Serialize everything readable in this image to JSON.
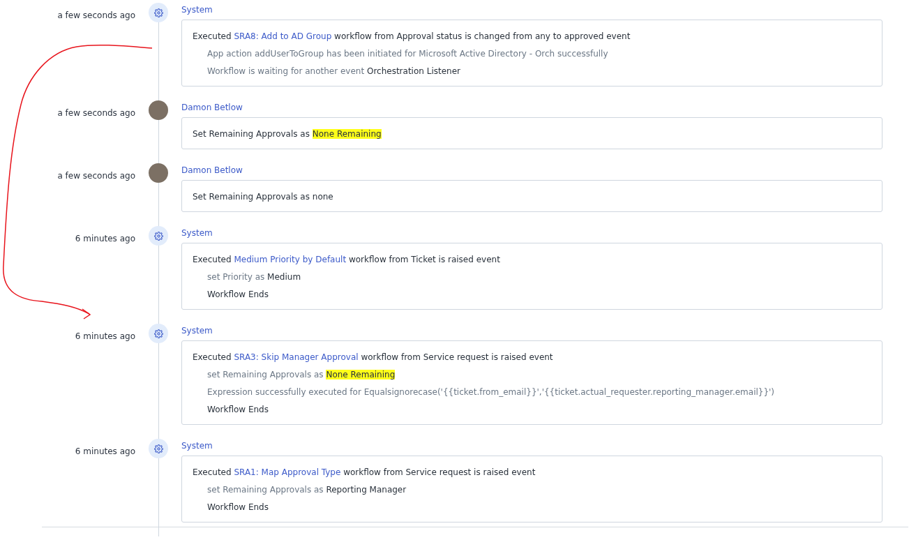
{
  "events": [
    {
      "time": "a few seconds ago",
      "actor": {
        "kind": "system",
        "name": "System"
      },
      "lines": [
        {
          "kind": "head",
          "segments": [
            {
              "kind": "text",
              "text": "Executed ",
              "highlighted": false
            },
            {
              "kind": "link",
              "text": "SRA8: Add to AD Group",
              "highlighted": false
            },
            {
              "kind": "text",
              "text": " workflow from Approval status is changed from any to approved event",
              "highlighted": false
            }
          ]
        },
        {
          "kind": "step",
          "segments": [
            {
              "kind": "muted",
              "text": "App action addUserToGroup has been initiated for Microsoft Active Directory - Orch successfully",
              "highlighted": false
            }
          ]
        },
        {
          "kind": "step",
          "segments": [
            {
              "kind": "muted",
              "text": "Workflow is waiting for another event ",
              "highlighted": false
            },
            {
              "kind": "text",
              "text": "Orchestration Listener",
              "highlighted": false
            }
          ]
        }
      ]
    },
    {
      "time": "a few seconds ago",
      "actor": {
        "kind": "user",
        "name": "Damon Betlow"
      },
      "lines": [
        {
          "kind": "head",
          "segments": [
            {
              "kind": "text",
              "text": "Set Remaining Approvals as ",
              "highlighted": false
            },
            {
              "kind": "text",
              "text": "None Remaining",
              "highlighted": true
            }
          ]
        }
      ]
    },
    {
      "time": "a few seconds ago",
      "actor": {
        "kind": "user",
        "name": "Damon Betlow"
      },
      "lines": [
        {
          "kind": "head",
          "segments": [
            {
              "kind": "text",
              "text": "Set Remaining Approvals as none",
              "highlighted": false
            }
          ]
        }
      ]
    },
    {
      "time": "6 minutes ago",
      "actor": {
        "kind": "system",
        "name": "System"
      },
      "lines": [
        {
          "kind": "head",
          "segments": [
            {
              "kind": "text",
              "text": "Executed ",
              "highlighted": false
            },
            {
              "kind": "link",
              "text": "Medium Priority by Default",
              "highlighted": false
            },
            {
              "kind": "text",
              "text": " workflow from Ticket is raised event",
              "highlighted": false
            }
          ]
        },
        {
          "kind": "step",
          "segments": [
            {
              "kind": "muted",
              "text": "set Priority as ",
              "highlighted": false
            },
            {
              "kind": "text",
              "text": "Medium",
              "highlighted": false
            }
          ]
        },
        {
          "kind": "step",
          "segments": [
            {
              "kind": "text",
              "text": "Workflow Ends",
              "highlighted": false
            }
          ]
        }
      ]
    },
    {
      "time": "6 minutes ago",
      "actor": {
        "kind": "system",
        "name": "System"
      },
      "lines": [
        {
          "kind": "head",
          "segments": [
            {
              "kind": "text",
              "text": "Executed ",
              "highlighted": false
            },
            {
              "kind": "link",
              "text": "SRA3: Skip Manager Approval",
              "highlighted": false
            },
            {
              "kind": "text",
              "text": " workflow from Service request is raised event",
              "highlighted": false
            }
          ]
        },
        {
          "kind": "step",
          "segments": [
            {
              "kind": "muted",
              "text": "set Remaining Approvals as ",
              "highlighted": false
            },
            {
              "kind": "text",
              "text": "None Remaining",
              "highlighted": true
            }
          ]
        },
        {
          "kind": "step",
          "segments": [
            {
              "kind": "muted",
              "text": "Expression successfully executed for Equalsignorecase('{{ticket.from_email}}','{{ticket.actual_requester.reporting_manager.email}}')",
              "highlighted": false
            }
          ]
        },
        {
          "kind": "step",
          "segments": [
            {
              "kind": "text",
              "text": "Workflow Ends",
              "highlighted": false
            }
          ]
        }
      ]
    },
    {
      "time": "6 minutes ago",
      "actor": {
        "kind": "system",
        "name": "System"
      },
      "lines": [
        {
          "kind": "head",
          "segments": [
            {
              "kind": "text",
              "text": "Executed ",
              "highlighted": false
            },
            {
              "kind": "link",
              "text": "SRA1: Map Approval Type",
              "highlighted": false
            },
            {
              "kind": "text",
              "text": " workflow from Service request is raised event",
              "highlighted": false
            }
          ]
        },
        {
          "kind": "step",
          "segments": [
            {
              "kind": "muted",
              "text": "set Remaining Approvals as ",
              "highlighted": false
            },
            {
              "kind": "text",
              "text": "Reporting Manager",
              "highlighted": false
            }
          ]
        },
        {
          "kind": "step",
          "segments": [
            {
              "kind": "text",
              "text": "Workflow Ends",
              "highlighted": false
            }
          ]
        }
      ]
    }
  ]
}
